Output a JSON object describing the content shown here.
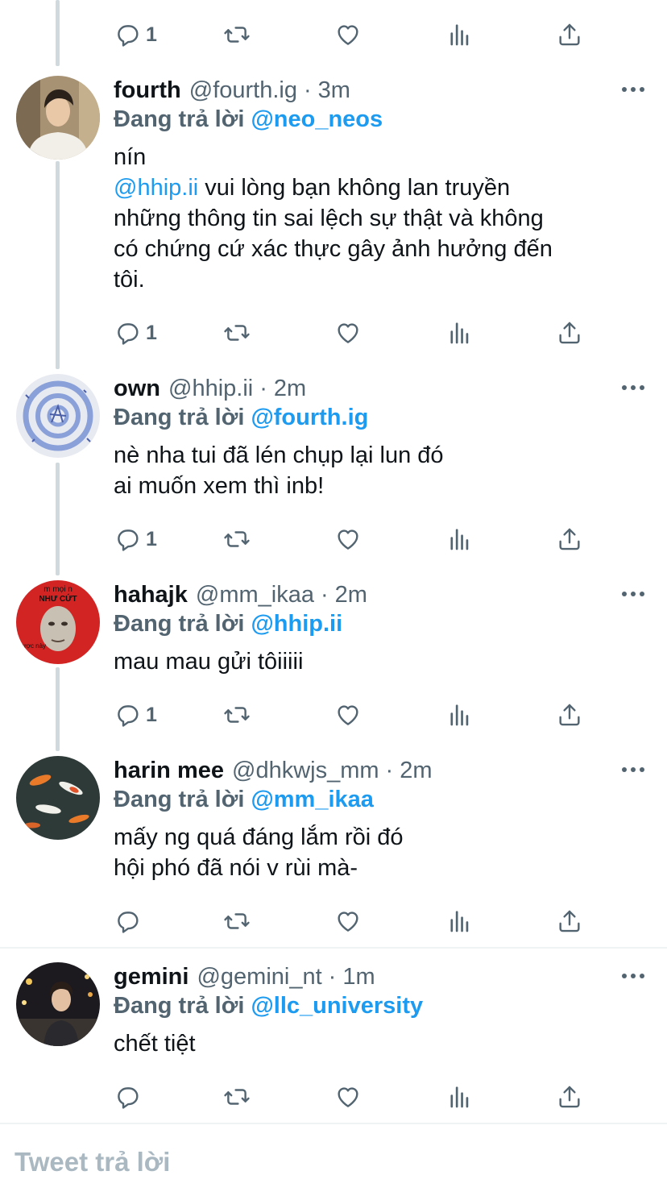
{
  "colors": {
    "accent": "#1d9bf0",
    "secondary": "#536471",
    "text": "#0f1419",
    "thread_line": "#cfd9de"
  },
  "top_actions": {
    "reply_count": "1"
  },
  "tweets": [
    {
      "name": "fourth",
      "handle": "@fourth.ig",
      "separator": "·",
      "time": "3m",
      "replying_label": "Đang trả lời",
      "replying_to": "@neo_neos",
      "lines": [
        [
          {
            "t": "nín",
            "mention": false
          }
        ],
        [
          {
            "t": "@hhip.ii",
            "mention": true
          },
          {
            "t": " vui lòng bạn không lan truyền",
            "mention": false
          }
        ],
        [
          {
            "t": "những thông tin sai lệch sự thật và không",
            "mention": false
          }
        ],
        [
          {
            "t": "có chứng cứ xác thực gây ảnh hưởng đến",
            "mention": false
          }
        ],
        [
          {
            "t": "tôi.",
            "mention": false
          }
        ]
      ],
      "reply_count": "1",
      "avatar_icon": "avatar-photo-man-white-sweater"
    },
    {
      "name": "own",
      "handle": "@hhip.ii",
      "separator": "·",
      "time": "2m",
      "replying_label": "Đang trả lời",
      "replying_to": "@fourth.ig",
      "lines": [
        [
          {
            "t": "nè nha tui đã lén chụp lại lun đó",
            "mention": false
          }
        ],
        [
          {
            "t": "ai muốn xem thì inb!",
            "mention": false
          }
        ]
      ],
      "reply_count": "1",
      "avatar_icon": "avatar-blue-spiral-doodle"
    },
    {
      "name": "hahajk",
      "handle": "@mm_ikaa",
      "separator": "·",
      "time": "2m",
      "replying_label": "Đang trả lời",
      "replying_to": "@hhip.ii",
      "lines": [
        [
          {
            "t": "mau mau gửi tôiiiii",
            "mention": false
          }
        ]
      ],
      "reply_count": "1",
      "avatar_icon": "avatar-meme-face-red",
      "avatar_text": [
        "m mọi n",
        "NHƯ CỨT",
        "được này"
      ]
    },
    {
      "name": "harin mee",
      "handle": "@dhkwjs_mm",
      "separator": "·",
      "time": "2m",
      "replying_label": "Đang trả lời",
      "replying_to": "@mm_ikaa",
      "lines": [
        [
          {
            "t": "mấy ng quá đáng lắm rồi đó",
            "mention": false
          }
        ],
        [
          {
            "t": "hội phó đã nói v rùi mà-",
            "mention": false
          }
        ]
      ],
      "reply_count": "",
      "avatar_icon": "avatar-koi-fish-pond"
    },
    {
      "name": "gemini",
      "handle": "@gemini_nt",
      "separator": "·",
      "time": "1m",
      "replying_label": "Đang trả lời",
      "replying_to": "@llc_university",
      "lines": [
        [
          {
            "t": "chết tiệt",
            "mention": false
          }
        ]
      ],
      "reply_count": "",
      "avatar_icon": "avatar-photo-man-night-street"
    }
  ],
  "compose": {
    "placeholder": "Tweet trả lời"
  }
}
